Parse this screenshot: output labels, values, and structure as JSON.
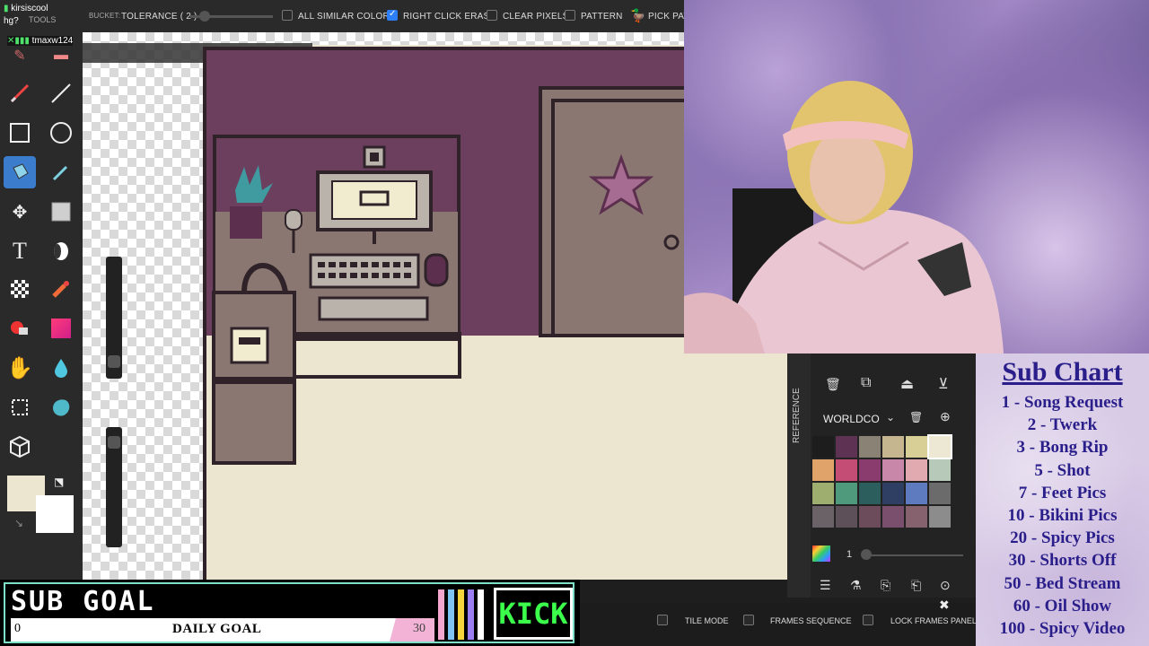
{
  "chat": {
    "user1": "kirsiscool",
    "line2": "hg?",
    "tools_label": "TOOLS",
    "user2": "tmaxw124"
  },
  "toolbar": {
    "bucket_label": "BUCKET:",
    "tolerance_label": "TOLERANCE ( 2 )",
    "all_similar_colors": "ALL SIMILAR COLORS",
    "right_click_erase": "RIGHT CLICK ERASE",
    "clear_pixels": "CLEAR PIXELS",
    "pattern": "PATTERN",
    "pick_pattern": "PICK PAT"
  },
  "panel": {
    "reference_tab": "REFERENCE",
    "palette_name": "WORLDCO",
    "layer_number": "1",
    "palette_colors": [
      "#1d1d1d",
      "#5d3252",
      "#8a8274",
      "#c5b68f",
      "#d8cf97",
      "#ece8d4",
      "#e0a36a",
      "#c44d76",
      "#8b3c6e",
      "#c887a8",
      "#e1aab0",
      "#b7c9b8",
      "#9dae6e",
      "#4f9a7d",
      "#2d5e5e",
      "#2e3f63",
      "#5f7bc0",
      "#6b6b6b",
      "#6a6266",
      "#5d5058",
      "#6c4b5b",
      "#7a4f6d",
      "#86626f",
      "#8c8c8c"
    ]
  },
  "bottombar": {
    "tile_mode": "TILE MODE",
    "frames_sequence": "FRAMES SEQUENCE",
    "lock_frames_panel": "LOCK FRAMES PANEL"
  },
  "subgoal": {
    "title": "SUB GOAL",
    "start": "0",
    "label": "DAILY GOAL",
    "goal": "30",
    "kick": "KICK",
    "stripe_colors": [
      "#f4a6cf",
      "#7fc4f2",
      "#f5d43c",
      "#9b7ff2",
      "#ffffff"
    ]
  },
  "subchart": {
    "title": "Sub Chart",
    "items": [
      "1 - Song Request",
      "2 - Twerk",
      "3 - Bong Rip",
      "5 - Shot",
      "7 - Feet Pics",
      "10 - Bikini Pics",
      "20 - Spicy Pics",
      "30 - Shorts Off",
      "50 - Bed Stream",
      "60 - Oil Show",
      "100 - Spicy Video"
    ]
  },
  "colors": {
    "accent": "#3b7ccc",
    "wall": "#6c3f5f",
    "floor": "#ece6d0",
    "subchart_text": "#2a1e8a"
  }
}
